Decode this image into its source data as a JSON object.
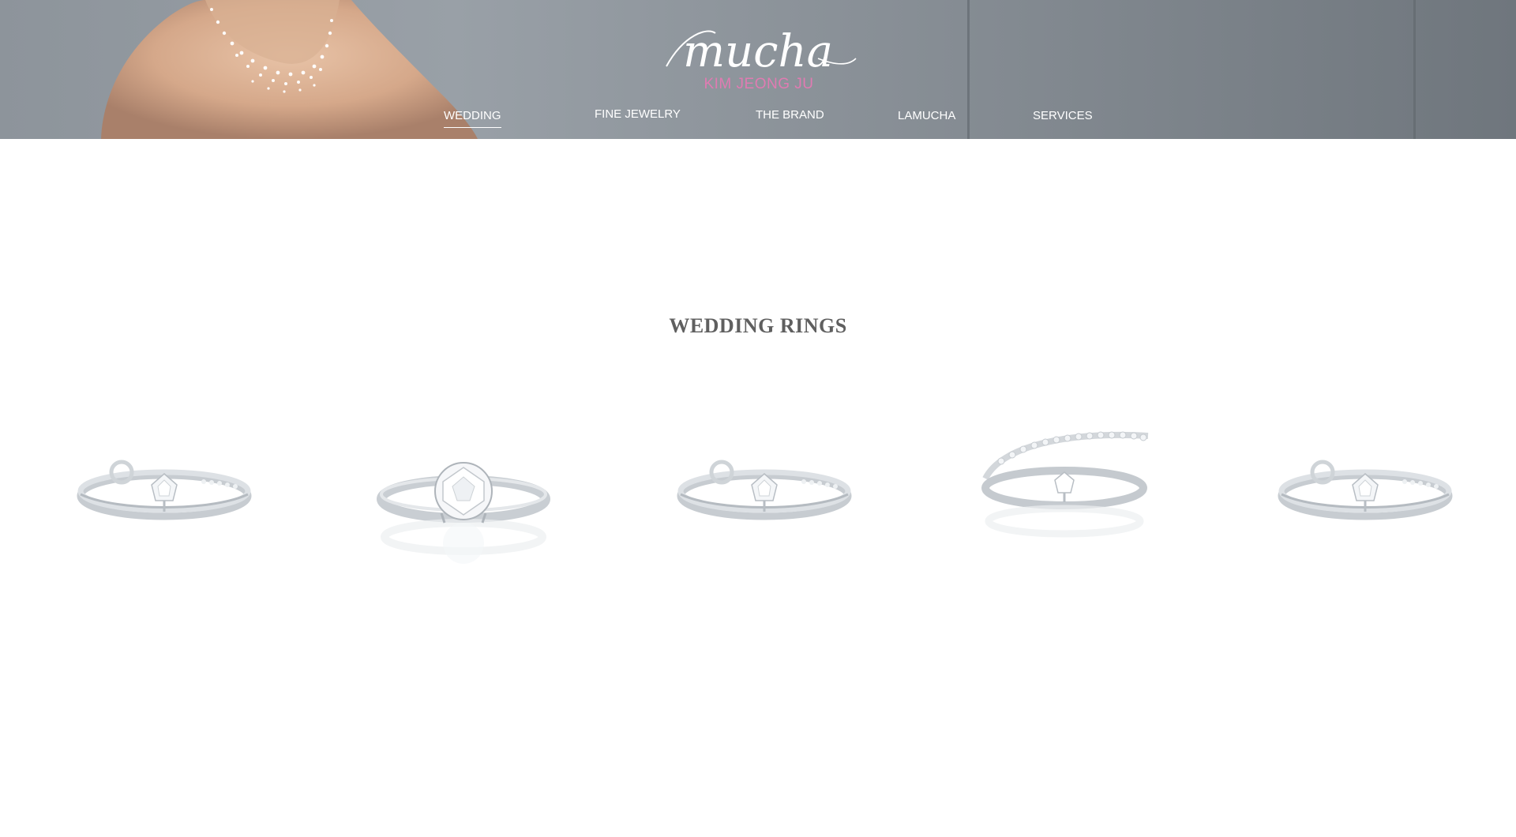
{
  "header": {
    "logo": {
      "script": "mucha",
      "subtitle": "KIM JEONG JU"
    },
    "nav": [
      {
        "label": "WEDDING",
        "active": true
      },
      {
        "label": "FINE JEWELRY",
        "active": false
      },
      {
        "label": "THE BRAND",
        "active": false
      },
      {
        "label": "LAMUCHA",
        "active": false
      },
      {
        "label": "SERVICES",
        "active": false
      }
    ]
  },
  "main": {
    "section_title": "WEDDING RINGS",
    "rings": [
      {
        "style": "twist-loop-set",
        "icon": "ring-set-image"
      },
      {
        "style": "solitaire-reflection",
        "icon": "ring-image"
      },
      {
        "style": "twist-loop-set",
        "icon": "ring-set-image"
      },
      {
        "style": "pave-band-solitaire-set",
        "icon": "ring-set-image"
      },
      {
        "style": "twist-loop-set",
        "icon": "ring-set-image"
      }
    ]
  },
  "colors": {
    "header_bg": "#8d949b",
    "logo_accent": "#e07bb2",
    "nav_text": "#ffffff",
    "title_text": "#5f5f5f"
  }
}
